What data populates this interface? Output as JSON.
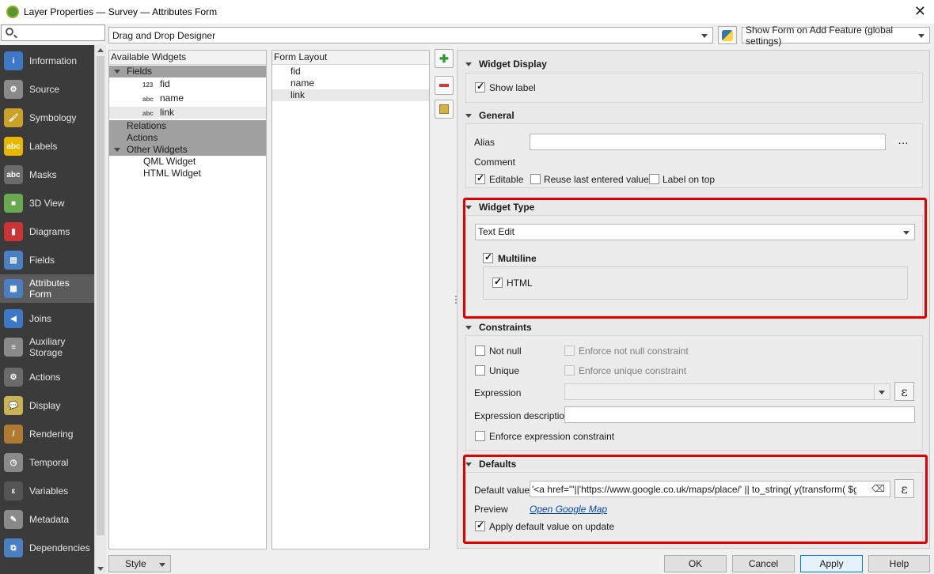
{
  "window": {
    "title": "Layer Properties — Survey — Attributes Form",
    "close_glyph": "✕"
  },
  "sidebar": {
    "items": [
      {
        "label": "Information",
        "icon": "info-icon",
        "color": "#3d78c6",
        "glyph": "i"
      },
      {
        "label": "Source",
        "icon": "gear-icon",
        "color": "#8a8a8a",
        "glyph": "⚙"
      },
      {
        "label": "Symbology",
        "icon": "paintbrush-icon",
        "color": "#c9a227",
        "glyph": "🖌"
      },
      {
        "label": "Labels",
        "icon": "labels-icon",
        "color": "#e8b800",
        "glyph": "abc"
      },
      {
        "label": "Masks",
        "icon": "masks-icon",
        "color": "#6b6b6b",
        "glyph": "abc"
      },
      {
        "label": "3D View",
        "icon": "cube-icon",
        "color": "#6aa84f",
        "glyph": "■"
      },
      {
        "label": "Diagrams",
        "icon": "diagrams-icon",
        "color": "#cc3333",
        "glyph": "▮"
      },
      {
        "label": "Fields",
        "icon": "fields-icon",
        "color": "#4a7fc1",
        "glyph": "▤"
      },
      {
        "label": "Attributes\nForm",
        "icon": "form-icon",
        "color": "#4a7fc1",
        "glyph": "▦"
      },
      {
        "label": "Joins",
        "icon": "joins-icon",
        "color": "#3d78c6",
        "glyph": "◀"
      },
      {
        "label": "Auxiliary\nStorage",
        "icon": "database-icon",
        "color": "#8a8a8a",
        "glyph": "≡"
      },
      {
        "label": "Actions",
        "icon": "actions-icon",
        "color": "#6b6b6b",
        "glyph": "⚙"
      },
      {
        "label": "Display",
        "icon": "speech-bubble-icon",
        "color": "#c9b455",
        "glyph": "💬"
      },
      {
        "label": "Rendering",
        "icon": "brush-icon",
        "color": "#b07a30",
        "glyph": "/"
      },
      {
        "label": "Temporal",
        "icon": "clock-icon",
        "color": "#8a8a8a",
        "glyph": "◷"
      },
      {
        "label": "Variables",
        "icon": "epsilon-icon",
        "color": "#555555",
        "glyph": "ε"
      },
      {
        "label": "Metadata",
        "icon": "metadata-icon",
        "color": "#8a8a8a",
        "glyph": "✎"
      },
      {
        "label": "Dependencies",
        "icon": "dependencies-icon",
        "color": "#4a7fc1",
        "glyph": "⧉"
      }
    ],
    "active_index": 8
  },
  "toolbar": {
    "designer_mode": "Drag and Drop Designer",
    "python_icon": "python-icon",
    "show_form": "Show Form on Add Feature (global settings)"
  },
  "available_widgets": {
    "header": "Available Widgets",
    "fields_label": "Fields",
    "fields": [
      {
        "type": "123",
        "name": "fid"
      },
      {
        "type": "abc",
        "name": "name"
      },
      {
        "type": "abc",
        "name": "link"
      }
    ],
    "relations_label": "Relations",
    "actions_label": "Actions",
    "other_label": "Other Widgets",
    "other": [
      "QML Widget",
      "HTML Widget"
    ]
  },
  "form_layout": {
    "header": "Form Layout",
    "items": [
      "fid",
      "name",
      "link"
    ]
  },
  "widget_display": {
    "title": "Widget Display",
    "show_label": "Show label"
  },
  "general": {
    "title": "General",
    "alias_label": "Alias",
    "alias_value": "",
    "ellipsis": "…",
    "comment_label": "Comment",
    "editable": "Editable",
    "reuse": "Reuse last entered value",
    "label_on_top": "Label on top"
  },
  "widget_type": {
    "title": "Widget Type",
    "selected": "Text Edit",
    "multiline": "Multiline",
    "html": "HTML"
  },
  "constraints": {
    "title": "Constraints",
    "not_null": "Not null",
    "enforce_not_null": "Enforce not null constraint",
    "unique": "Unique",
    "enforce_unique": "Enforce unique constraint",
    "expression_label": "Expression",
    "expression_desc_label": "Expression description",
    "enforce_expression": "Enforce expression constraint",
    "epsilon": "ε"
  },
  "defaults": {
    "title": "Defaults",
    "default_value_label": "Default value",
    "default_value": "'<a href=\"'||'https://www.google.co.uk/maps/place/' || to_string( y(transform( $geometr",
    "clear_glyph": "⌫",
    "preview_label": "Preview",
    "preview_link": "Open Google Map",
    "apply_on_update": "Apply default value on update",
    "epsilon": "ε"
  },
  "footer": {
    "style_label": "Style",
    "ok": "OK",
    "cancel": "Cancel",
    "apply": "Apply",
    "help": "Help"
  },
  "colors": {
    "highlight_red": "#e00000",
    "sidebar_bg": "#3b3b3b",
    "link": "#0645ad"
  }
}
